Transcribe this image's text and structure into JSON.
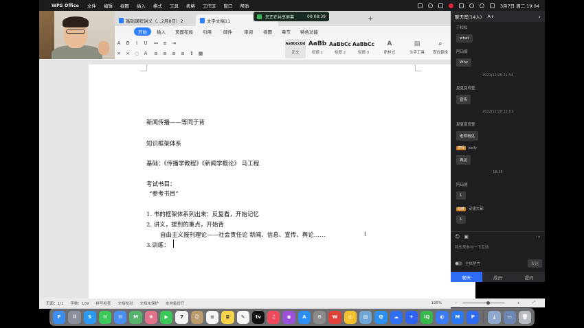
{
  "menubar": {
    "app_name": "WPS Office",
    "menus": [
      "文件",
      "编辑",
      "视图",
      "插入",
      "格式",
      "工具",
      "表格",
      "工作区",
      "窗口",
      "帮助"
    ],
    "datetime": "3月7日 周二 19:04"
  },
  "meeting": {
    "status": "您正在共享屏幕",
    "timer": "00:08:39"
  },
  "tabs": {
    "doc1": "基础课程讲义（...2月8日）2",
    "doc2": "文字文稿11",
    "add": "+"
  },
  "ribbon": {
    "tabs": [
      "开始",
      "插入",
      "页面布局",
      "引用",
      "邮件",
      "审阅",
      "视图",
      "章节",
      "特色功能"
    ]
  },
  "toolbar": {
    "styles": [
      {
        "preview": "AaBbCcDd",
        "caption": "正文"
      },
      {
        "preview": "AaBb",
        "caption": "标题 1"
      },
      {
        "preview": "AaBbCc",
        "caption": "标题 2"
      },
      {
        "preview": "AaBbCc",
        "caption": "标题 3"
      }
    ],
    "new_style": "新样式",
    "text_tools": "文字工具",
    "find_replace": "查找替换"
  },
  "document": {
    "lines": [
      "新闻传播——等同于背",
      "知识框架体系",
      "基础：《传播学教程》《新闻学概论》      马工程",
      "考试书目：",
      "“参考书目”",
      "1.  书的框架体系列出来：反复看，开始记忆",
      "2.  讲义，提到的重点，开始背",
      "自由主义报刊理论——社会责任论    新闻、信息、宣传、舆论……",
      "3.训练："
    ]
  },
  "status": {
    "page": "页面：1/1",
    "words": "字数：109",
    "spell": "拼写检查",
    "proof": "文档校对",
    "protect": "文档未保护",
    "sync": "本地备份开",
    "zoom": "195%",
    "minus": "−",
    "plus": "+"
  },
  "chat": {
    "title": "聊天室(14人)",
    "font_btn": "A+",
    "messages": [
      {
        "name": "于松松",
        "text": "what"
      },
      {
        "name": "阿玛德",
        "text": "Why"
      },
      {
        "time": "2022/12/28 21:54"
      },
      {
        "name": "夏夏夏规整",
        "text": "宣传"
      },
      {
        "time": "2022/12/28 22:01"
      },
      {
        "name": "夏夏夏规整",
        "text": "老师再见"
      },
      {
        "role": "讲师",
        "name": "kelly",
        "text": "再见"
      },
      {
        "time": "18:58"
      },
      {
        "name": "阿玛德",
        "text": "1"
      },
      {
        "role": "助教",
        "name": "安德大都",
        "text": "1"
      }
    ],
    "input_placeholder": "我也来参与一下互动",
    "mute_label": "全体禁言",
    "send": "发送",
    "footer_tabs": [
      "聊天",
      "成员",
      "提问"
    ]
  },
  "dock": {
    "apps": [
      {
        "name": "finder",
        "color": "#3b8ef0",
        "label": "F"
      },
      {
        "name": "launchpad",
        "color": "#8a8f99",
        "label": "⠿"
      },
      {
        "name": "safari",
        "color": "#2b9af3",
        "label": "S"
      },
      {
        "name": "messages",
        "color": "#3cc75a",
        "label": "✉"
      },
      {
        "name": "mail",
        "color": "#4a8ff0",
        "label": "✉"
      },
      {
        "name": "maps",
        "color": "#55b36c",
        "label": "M"
      },
      {
        "name": "photos",
        "color": "#e0738b",
        "label": "❀"
      },
      {
        "name": "facetime",
        "color": "#3cc75a",
        "label": "▶"
      },
      {
        "name": "calendar",
        "color": "#f2f2f2",
        "label": "7"
      },
      {
        "name": "contacts",
        "color": "#b99a6d",
        "label": "☺"
      },
      {
        "name": "reminders",
        "color": "#f5f5f5",
        "label": "≡"
      },
      {
        "name": "notes",
        "color": "#f6d44a",
        "label": "≣"
      },
      {
        "name": "freeform",
        "color": "#f5f5f5",
        "label": "✎"
      },
      {
        "name": "tv",
        "color": "#111111",
        "label": "tv"
      },
      {
        "name": "music",
        "color": "#f24a5c",
        "label": "♫"
      },
      {
        "name": "podcasts",
        "color": "#9b52d9",
        "label": "◉"
      },
      {
        "name": "app-store",
        "color": "#2b8ff3",
        "label": "A"
      },
      {
        "name": "system-settings",
        "color": "#8a8a8a",
        "label": "⚙"
      },
      {
        "name": "wps",
        "color": "#e2413a",
        "label": "W"
      },
      {
        "name": "chrome",
        "color": "#f2c12e",
        "label": "◎"
      },
      {
        "name": "preview",
        "color": "#6fa6d6",
        "label": "▤"
      },
      {
        "name": "qq",
        "color": "#2d8ff0",
        "label": "Q"
      },
      {
        "name": "baidu-netdisk",
        "color": "#2f6ff2",
        "label": "☁"
      },
      {
        "name": "feishu",
        "color": "#2f62f0",
        "label": "✈"
      },
      {
        "name": "iqiyi",
        "color": "#38b84c",
        "label": "iQ"
      },
      {
        "name": "ai-app",
        "color": "#3b7af2",
        "label": "◐"
      },
      {
        "name": "tencent-meeting",
        "color": "#2b79f2",
        "label": "M"
      },
      {
        "name": "pdf-app",
        "color": "#2f6bf0",
        "label": "P"
      },
      {
        "name": "downloads",
        "color": "#8fa8c9",
        "label": "⤓"
      },
      {
        "name": "desktop",
        "color": "#6b86b0",
        "label": "▭"
      },
      {
        "name": "trash",
        "color": "#b8bcc4",
        "label": "🗑"
      }
    ]
  }
}
